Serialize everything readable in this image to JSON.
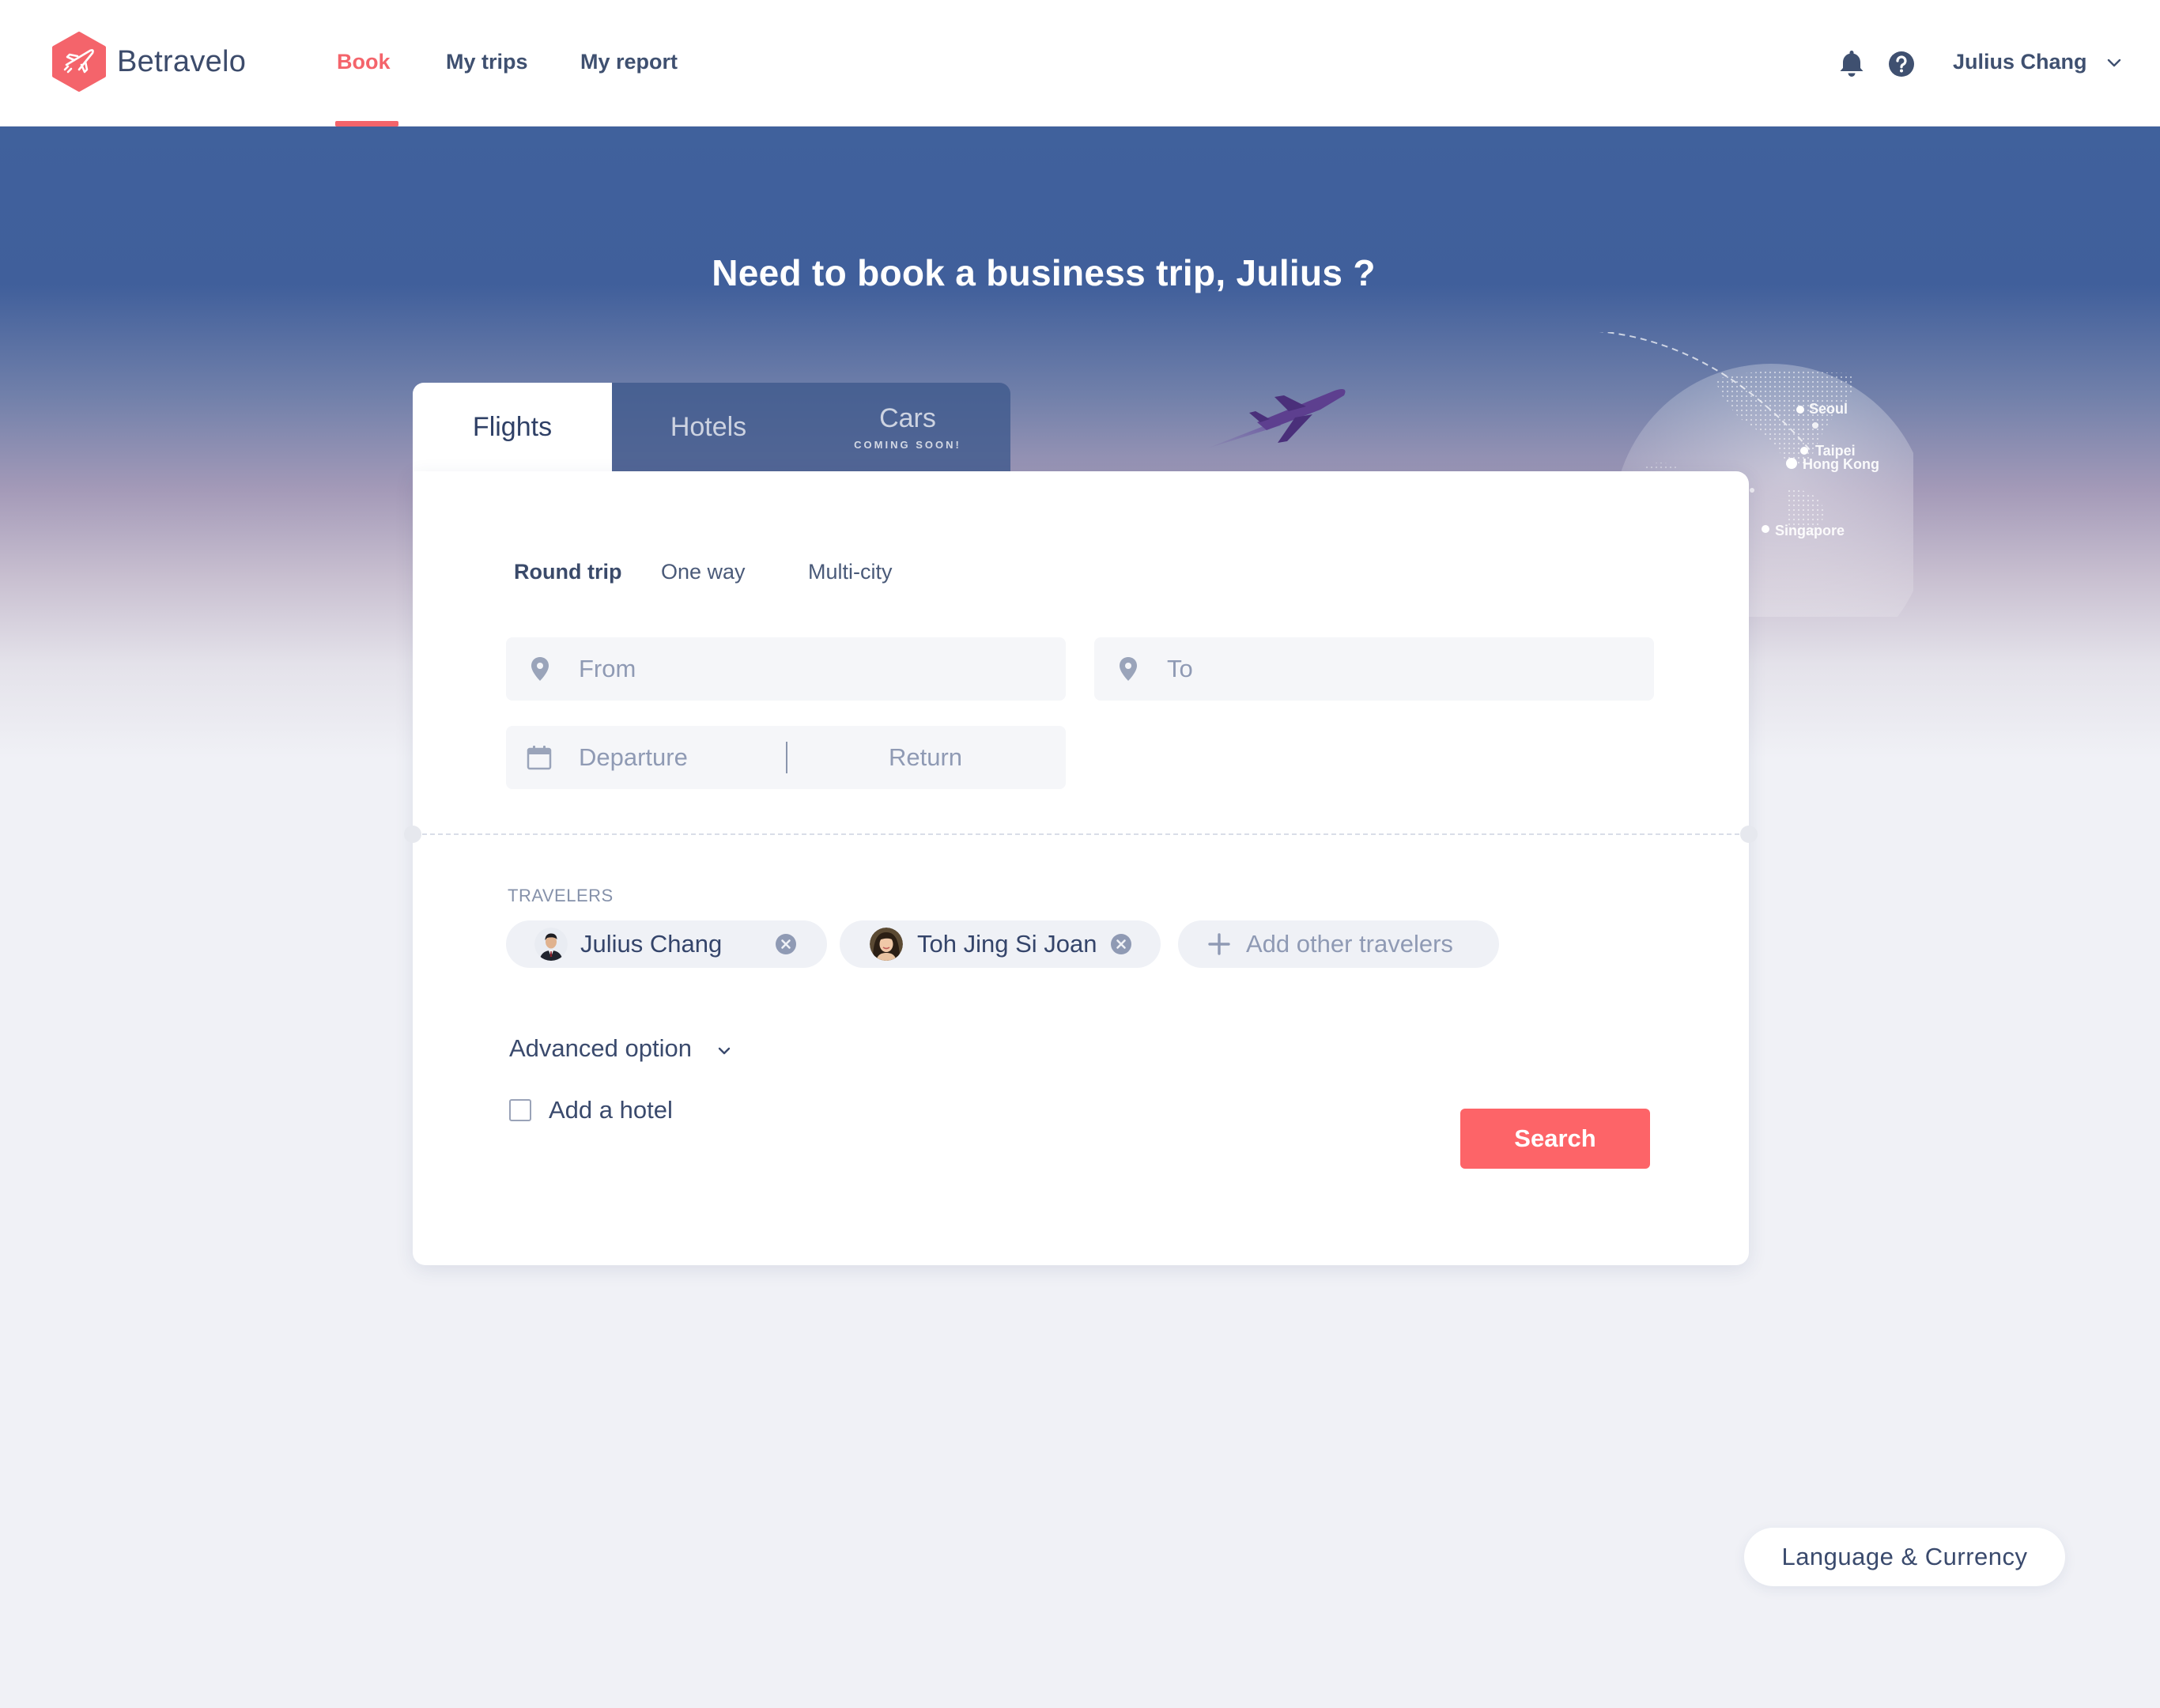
{
  "app": {
    "name": "Betravelo"
  },
  "nav": {
    "items": [
      {
        "label": "Book",
        "active": true
      },
      {
        "label": "My trips",
        "active": false
      },
      {
        "label": "My report",
        "active": false
      }
    ]
  },
  "user": {
    "name": "Julius Chang"
  },
  "hero": {
    "headline": "Need to book a business trip, Julius ?",
    "cities": [
      "Seoul",
      "Taipei",
      "Hong Kong",
      "Singapore"
    ]
  },
  "tabs": {
    "flights": "Flights",
    "hotels": "Hotels",
    "cars": "Cars",
    "cars_badge": "COMING SOON!"
  },
  "trip_types": [
    {
      "label": "Round trip",
      "active": true
    },
    {
      "label": "One way",
      "active": false
    },
    {
      "label": "Multi-city",
      "active": false
    }
  ],
  "form": {
    "from_placeholder": "From",
    "to_placeholder": "To",
    "departure_placeholder": "Departure",
    "return_placeholder": "Return"
  },
  "travelers": {
    "label": "TRAVELERS",
    "list": [
      {
        "name": "Julius Chang"
      },
      {
        "name": "Toh Jing Si Joan"
      }
    ],
    "add_label": "Add other travelers"
  },
  "advanced_option": "Advanced option",
  "add_hotel": {
    "label": "Add a hotel",
    "checked": false
  },
  "search_button": "Search",
  "language_currency": "Language & Currency",
  "colors": {
    "accent": "#f4646b",
    "search_button": "#fd6468",
    "hero_top": "#40619c",
    "text_primary": "#3f5070",
    "placeholder": "#8f9ab4"
  },
  "icons": [
    "logo-plane-icon",
    "bell-icon",
    "help-icon",
    "chevron-down-icon",
    "location-pin-icon",
    "calendar-icon",
    "remove-icon",
    "plus-icon",
    "plane-illustration",
    "globe-illustration"
  ]
}
